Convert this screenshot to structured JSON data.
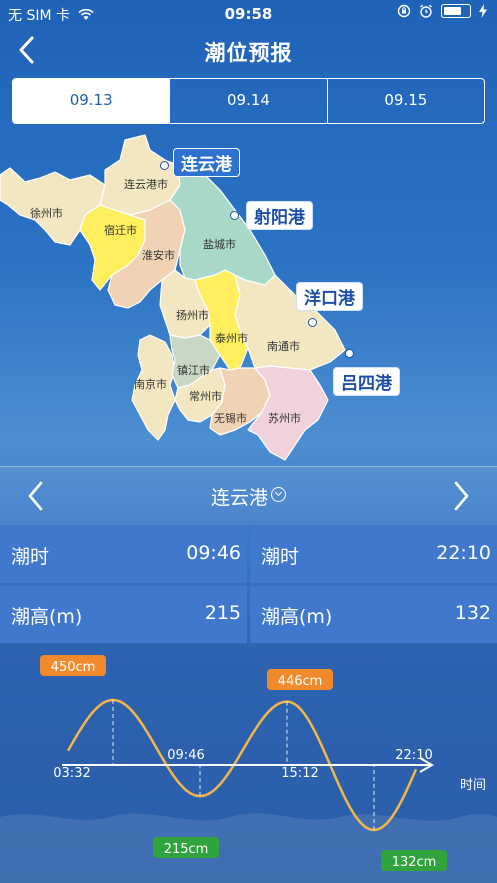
{
  "status_bar": {
    "carrier": "无 SIM 卡",
    "time": "09:58",
    "icons": [
      "wifi-icon",
      "orientation-lock-icon",
      "alarm-icon",
      "battery-icon",
      "charging-icon"
    ],
    "battery_level": 0.75
  },
  "header": {
    "title": "潮位预报",
    "back_icon": "chevron-left-icon"
  },
  "date_tabs": [
    {
      "label": "09.13",
      "active": true
    },
    {
      "label": "09.14",
      "active": false
    },
    {
      "label": "09.15",
      "active": false
    }
  ],
  "map": {
    "cities": [
      "徐州市",
      "连云港市",
      "宿迁市",
      "淮安市",
      "盐城市",
      "扬州市",
      "泰州市",
      "南通市",
      "南京市",
      "镇江市",
      "常州市",
      "无锡市",
      "苏州市"
    ],
    "ports": [
      {
        "name": "连云港",
        "selected": true
      },
      {
        "name": "射阳港",
        "selected": false
      },
      {
        "name": "洋口港",
        "selected": false
      },
      {
        "name": "吕四港",
        "selected": false
      }
    ],
    "colors": {
      "yellow": "#ffef5e",
      "beige": "#f2e7c0",
      "peach": "#f0d3b5",
      "teal": "#a8d8c7",
      "pink": "#efd2dc"
    }
  },
  "station": {
    "name": "连云港",
    "prev_icon": "chevron-left-icon",
    "next_icon": "chevron-right-icon",
    "dropdown_icon": "chevron-down-circle-icon"
  },
  "tide_table": {
    "row1": [
      {
        "label": "潮时",
        "value": "09:46"
      },
      {
        "label": "潮时",
        "value": "22:10"
      }
    ],
    "row2": [
      {
        "label": "潮高(m)",
        "value": "215"
      },
      {
        "label": "潮高(m)",
        "value": "132"
      }
    ]
  },
  "chart_data": {
    "type": "line",
    "xlabel": "时间",
    "ylabel": "",
    "x_ticks": [
      "03:32",
      "09:46",
      "15:12",
      "22:10"
    ],
    "extremes": [
      {
        "time": "03:32",
        "height": 450,
        "kind": "high",
        "label": "450cm"
      },
      {
        "time": "09:46",
        "height": 215,
        "kind": "low",
        "label": "215cm"
      },
      {
        "time": "15:12",
        "height": 446,
        "kind": "high",
        "label": "446cm"
      },
      {
        "time": "22:10",
        "height": 132,
        "kind": "low",
        "label": "132cm"
      }
    ],
    "colors": {
      "curve": "#f2b64a",
      "high_label_bg": "#f08a2c",
      "low_label_bg": "#2fa43c",
      "axis": "#ffffff"
    }
  }
}
